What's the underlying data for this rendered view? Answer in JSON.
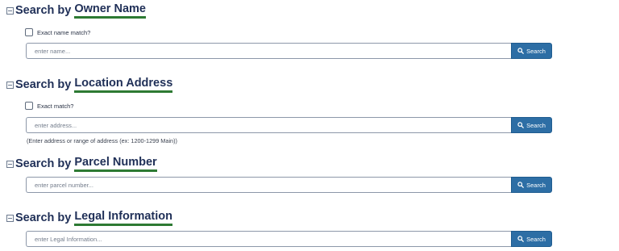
{
  "sections": {
    "owner": {
      "title_prefix": "Search by",
      "title_keyword": "Owner Name",
      "checkbox_label": "Exact name match?",
      "placeholder": "enter name...",
      "button_label": "Search"
    },
    "location": {
      "title_prefix": "Search by",
      "title_keyword": "Location Address",
      "checkbox_label": "Exact match?",
      "placeholder": "enter address...",
      "button_label": "Search",
      "hint": "(Enter address or range of address (ex: 1200-1299 Main))"
    },
    "parcel": {
      "title_prefix": "Search by",
      "title_keyword": "Parcel Number",
      "placeholder": "enter parcel number...",
      "button_label": "Search"
    },
    "legal": {
      "title_prefix": "Search by",
      "title_keyword": "Legal Information",
      "placeholder": "enter Legal Information...",
      "button_label": "Search"
    }
  },
  "colors": {
    "title_text": "#1f2f57",
    "title_underline": "#2d7a33",
    "button_bg": "#2d6ea5",
    "button_text": "#ffffff"
  },
  "icons": {
    "toggle": "collapse-toggle-icon",
    "search": "search-icon"
  }
}
